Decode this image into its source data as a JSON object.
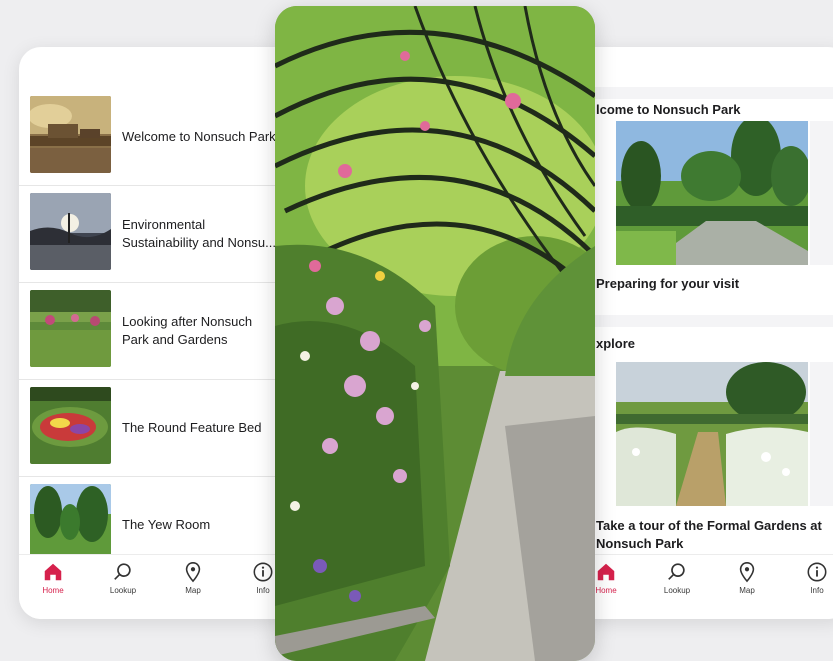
{
  "left_screen": {
    "items": [
      {
        "label": "Welcome to Nonsuch Park"
      },
      {
        "label": "Environmental\nSustainability and Nonsu..."
      },
      {
        "label": "Looking after Nonsuch\nPark and Gardens"
      },
      {
        "label": "The Round Feature Bed"
      },
      {
        "label": "The Yew Room"
      }
    ]
  },
  "tabs": [
    {
      "label": "Home",
      "icon": "home-icon"
    },
    {
      "label": "Lookup",
      "icon": "search-icon"
    },
    {
      "label": "Map",
      "icon": "map-pin-icon"
    },
    {
      "label": "Info",
      "icon": "info-icon"
    }
  ],
  "right_screen": {
    "welcome_title": "lcome to Nonsuch Park",
    "preparing_title": "Preparing for your visit",
    "explore_title": "xplore",
    "tour_title": "Take a tour of the Formal Gardens at\nNonsuch Park"
  },
  "colors": {
    "accent": "#d6214c",
    "background": "#eeeef0"
  }
}
